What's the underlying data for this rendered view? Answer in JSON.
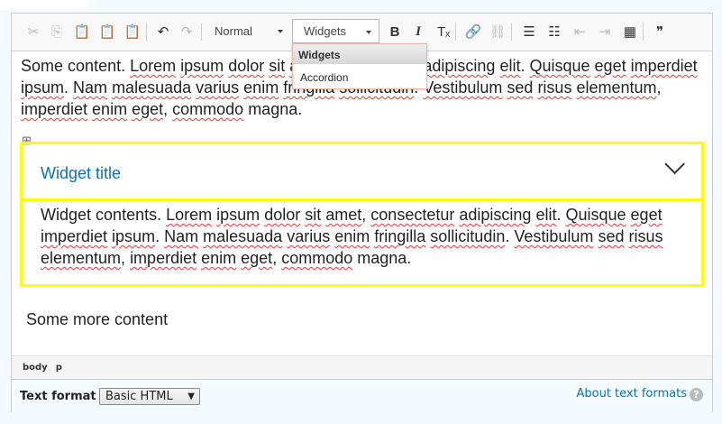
{
  "toolbar": {
    "format_value": "Normal",
    "widgets_value": "Widgets",
    "buttons": [
      {
        "name": "cut-icon",
        "glyph": "✂",
        "disabled": true
      },
      {
        "name": "copy-icon",
        "glyph": "⎘",
        "disabled": true
      },
      {
        "name": "paste-icon",
        "glyph": "📋",
        "disabled": false
      },
      {
        "name": "paste-text-icon",
        "glyph": "📋",
        "disabled": false
      },
      {
        "name": "paste-word-icon",
        "glyph": "📋",
        "disabled": false
      },
      {
        "name": "undo-icon",
        "glyph": "↶",
        "disabled": false
      },
      {
        "name": "redo-icon",
        "glyph": "↷",
        "disabled": true
      },
      {
        "name": "bold-icon",
        "glyph": "B",
        "disabled": false
      },
      {
        "name": "italic-icon",
        "glyph": "I",
        "disabled": false
      },
      {
        "name": "remove-format-icon",
        "glyph": "Tₓ",
        "disabled": false
      },
      {
        "name": "link-icon",
        "glyph": "🔗",
        "disabled": false
      },
      {
        "name": "unlink-icon",
        "glyph": "⛓",
        "disabled": true
      },
      {
        "name": "bulleted-list-icon",
        "glyph": "☰",
        "disabled": false
      },
      {
        "name": "numbered-list-icon",
        "glyph": "☷",
        "disabled": false
      },
      {
        "name": "outdent-icon",
        "glyph": "⇤",
        "disabled": true
      },
      {
        "name": "indent-icon",
        "glyph": "⇥",
        "disabled": true
      },
      {
        "name": "table-icon",
        "glyph": "▦",
        "disabled": false
      },
      {
        "name": "blockquote-icon",
        "glyph": "❞",
        "disabled": false
      }
    ]
  },
  "dropdown": {
    "header": "Widgets",
    "items": [
      "Accordion"
    ]
  },
  "content": {
    "paragraph1": "Some content. Lorem ipsum dolor sit amet, consectetur adipiscing elit. Quisque eget imperdiet ipsum. Nam malesuada varius enim fringilla sollicitudin. Vestibulum sed risus elementum, imperdiet enim eget, commodo magna.",
    "widget_title": "Widget title",
    "widget_contents": "Widget contents. Lorem ipsum dolor sit amet, consectetur adipiscing elit. Quisque eget imperdiet ipsum. Nam malesuada varius enim fringilla sollicitudin. Vestibulum sed risus elementum, imperdiet enim eget, commodo magna.",
    "more": "Some more content",
    "flagged_words": [
      "Lorem",
      "ipsum",
      "dolor",
      "sit",
      "amet",
      "consectetur",
      "adipiscing",
      "elit",
      "Quisque",
      "eget",
      "imperdiet",
      "Nam",
      "malesuada",
      "varius",
      "enim",
      "fringilla",
      "sollicitudin",
      "Vestibulum",
      "sed",
      "risus",
      "elementum",
      "commodo"
    ]
  },
  "pathbar": [
    "body",
    "p"
  ],
  "footer": {
    "label": "Text format",
    "select_value": "Basic HTML",
    "about_link": "About text formats"
  }
}
